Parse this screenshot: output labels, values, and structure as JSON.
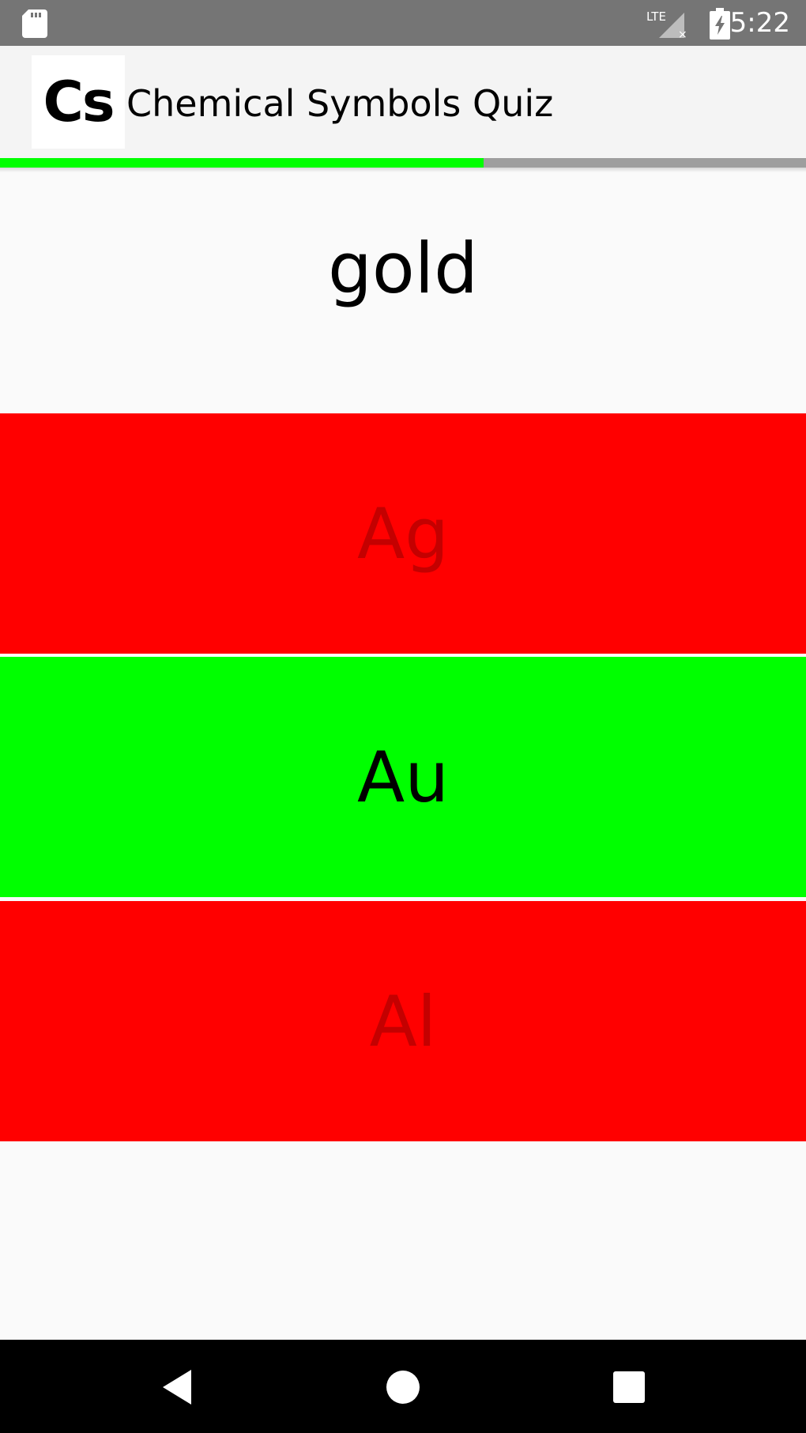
{
  "status_bar": {
    "network_label": "LTE",
    "time": "5:22"
  },
  "app_bar": {
    "logo_text": "Cs",
    "title": "Chemical Symbols Quiz"
  },
  "progress": {
    "fraction": 0.6
  },
  "quiz": {
    "question": "gold",
    "answers": [
      {
        "label": "Ag",
        "state": "wrong"
      },
      {
        "label": "Au",
        "state": "correct"
      },
      {
        "label": "Al",
        "state": "wrong"
      }
    ]
  },
  "colors": {
    "wrong_bg": "#ff0000",
    "wrong_text": "#c40000",
    "correct_bg": "#00ff00",
    "progress_fill": "#00ff00"
  },
  "nav_bar": {
    "icons": [
      "back-icon",
      "home-icon",
      "recents-icon"
    ]
  }
}
